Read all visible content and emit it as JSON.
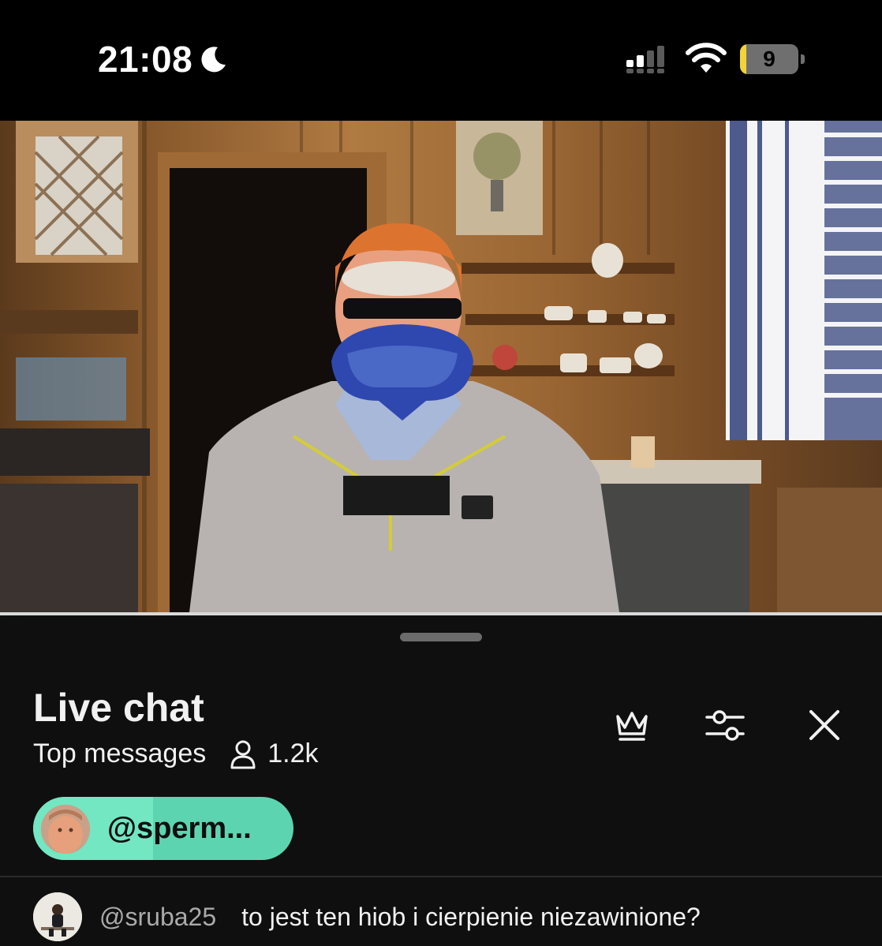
{
  "status_bar": {
    "time": "21:08",
    "battery_level": "9",
    "battery_fraction": 0.09
  },
  "chat": {
    "title": "Live chat",
    "mode": "Top messages",
    "viewer_count": "1.2k",
    "pinned_user": "@sperm...",
    "messages": [
      {
        "author": "@sruba25",
        "text": "to jest ten hiob i cierpienie niezawinione?"
      }
    ]
  },
  "icons": {
    "crown": "crown-icon",
    "filter": "sliders-icon",
    "close": "close-icon",
    "viewers": "person-icon"
  },
  "colors": {
    "pinned_chip": "#73e6c2",
    "battery": "#f3d33b",
    "panel_bg": "#0f0f0f"
  }
}
